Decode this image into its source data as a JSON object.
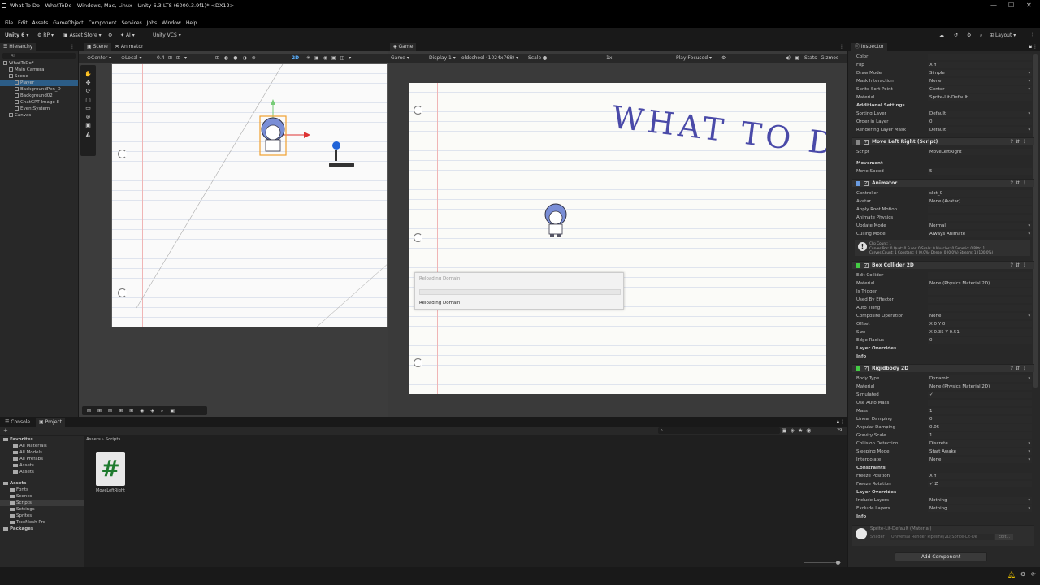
{
  "window": {
    "title": "What To Do - WhatToDo - Windows, Mac, Linux - Unity 6.3 LTS (6000.3.9f1)* <DX12>",
    "minimize": "—",
    "maximize": "☐",
    "close": "✕"
  },
  "menu": [
    "File",
    "Edit",
    "Assets",
    "GameObject",
    "Component",
    "Services",
    "Jobs",
    "Window",
    "Help"
  ],
  "toolbar": {
    "account": "Unity 6",
    "rp": "RP",
    "asset_store": "Asset Store",
    "ai": "AI",
    "vcs": "Unity VCS",
    "layout": "Layout"
  },
  "hierarchy": {
    "tab": "Hierarchy",
    "search_placeholder": "All",
    "items": [
      {
        "label": "WhatToDo*",
        "level": 0,
        "selected": false
      },
      {
        "label": "Main Camera",
        "level": 1,
        "selected": false
      },
      {
        "label": "Scene",
        "level": 1,
        "selected": false
      },
      {
        "label": "Player",
        "level": 2,
        "selected": true
      },
      {
        "label": "BackgroundPen_D",
        "level": 2,
        "selected": false
      },
      {
        "label": "Background02",
        "level": 2,
        "selected": false
      },
      {
        "label": "ChatGPT Image 8",
        "level": 2,
        "selected": false
      },
      {
        "label": "EventSystem",
        "level": 2,
        "selected": false
      },
      {
        "label": "Canvas",
        "level": 1,
        "selected": false
      }
    ]
  },
  "scene": {
    "tab_scene": "Scene",
    "tab_animator": "Animator",
    "pivot": "Center",
    "space": "Local",
    "snap": "0.4",
    "mode_2d": "2D"
  },
  "game": {
    "tab": "Game",
    "mode": "Game",
    "display": "Display 1",
    "resolution": "oldschool (1024x768)",
    "scale_label": "Scale",
    "scale_value": "1x",
    "play_focused": "Play Focused",
    "stats": "Stats",
    "gizmos": "Gizmos",
    "title_art": "WHAT TO DO",
    "dialog_title": "Reloading Domain",
    "dialog_status": "Reloading Domain"
  },
  "inspector": {
    "tab": "Inspector",
    "top_rows": [
      {
        "k": "Color",
        "v": ""
      },
      {
        "k": "Flip",
        "v": "X    Y"
      },
      {
        "k": "Draw Mode",
        "v": "Simple",
        "dd": true
      },
      {
        "k": "Mask Interaction",
        "v": "None",
        "dd": true
      },
      {
        "k": "Sprite Sort Point",
        "v": "Center",
        "dd": true
      },
      {
        "k": "Material",
        "v": "Sprite-Lit-Default"
      }
    ],
    "additional_settings": "Additional Settings",
    "additional_rows": [
      {
        "k": "Sorting Layer",
        "v": "Default",
        "dd": true
      },
      {
        "k": "Order in Layer",
        "v": "0"
      },
      {
        "k": "Rendering Layer Mask",
        "v": "Default",
        "dd": true
      }
    ],
    "move_comp": "Move Left Right (Script)",
    "move_rows": [
      {
        "k": "Script",
        "v": "MoveLeftRight"
      }
    ],
    "movement_header": "Movement",
    "move_speed": {
      "k": "Move Speed",
      "v": "5"
    },
    "animator_comp": "Animator",
    "animator_rows": [
      {
        "k": "Controller",
        "v": "slot_0"
      },
      {
        "k": "Avatar",
        "v": "None (Avatar)"
      },
      {
        "k": "Apply Root Motion",
        "v": ""
      },
      {
        "k": "Animate Physics",
        "v": ""
      },
      {
        "k": "Update Mode",
        "v": "Normal",
        "dd": true
      },
      {
        "k": "Culling Mode",
        "v": "Always Animate",
        "dd": true
      }
    ],
    "clip_info": "Clip Count: 1\nCurves Pos: 0 Quat: 0 Euler: 0 Scale: 0 Muscles: 0 Generic: 0 PPtr: 1\nCurves Count: 1 Constant: 0 (0.0%) Dense: 0 (0.0%) Stream: 1 (100.0%)",
    "box_comp": "Box Collider 2D",
    "box_rows": [
      {
        "k": "Edit Collider",
        "v": ""
      },
      {
        "k": "Material",
        "v": "None (Physics Material 2D)"
      },
      {
        "k": "Is Trigger",
        "v": ""
      },
      {
        "k": "Used By Effector",
        "v": ""
      },
      {
        "k": "Auto Tiling",
        "v": ""
      },
      {
        "k": "Composite Operation",
        "v": "None",
        "dd": true
      },
      {
        "k": "Offset",
        "v": "X 0          Y 0"
      },
      {
        "k": "Size",
        "v": "X 0.35       Y 0.51"
      },
      {
        "k": "Edge Radius",
        "v": "0"
      }
    ],
    "layer_overrides": "Layer Overrides",
    "info": "Info",
    "rb_comp": "Rigidbody 2D",
    "rb_rows": [
      {
        "k": "Body Type",
        "v": "Dynamic",
        "dd": true
      },
      {
        "k": "Material",
        "v": "None (Physics Material 2D)"
      },
      {
        "k": "Simulated",
        "v": "✓"
      },
      {
        "k": "Use Auto Mass",
        "v": ""
      },
      {
        "k": "Mass",
        "v": "1"
      },
      {
        "k": "Linear Damping",
        "v": "0"
      },
      {
        "k": "Angular Damping",
        "v": "0.05"
      },
      {
        "k": "Gravity Scale",
        "v": "1"
      },
      {
        "k": "Collision Detection",
        "v": "Discrete",
        "dd": true
      },
      {
        "k": "Sleeping Mode",
        "v": "Start Awake",
        "dd": true
      },
      {
        "k": "Interpolate",
        "v": "None",
        "dd": true
      }
    ],
    "constraints": "Constraints",
    "constraint_rows": [
      {
        "k": "Freeze Position",
        "v": "X    Y"
      },
      {
        "k": "Freeze Rotation",
        "v": "✓ Z"
      }
    ],
    "layer_overrides2": "Layer Overrides",
    "override_rows": [
      {
        "k": "Include Layers",
        "v": "Nothing",
        "dd": true
      },
      {
        "k": "Exclude Layers",
        "v": "Nothing",
        "dd": true
      }
    ],
    "info2": "Info",
    "material_name": "Sprite-Lit-Default (Material)",
    "shader_label": "Shader",
    "shader_value": "Universal Render Pipeline/2D/Sprite-Lit-De",
    "edit_label": "Edit...",
    "add_component": "Add Component"
  },
  "project": {
    "tab_console": "Console",
    "tab_project": "Project",
    "favorites": "Favorites",
    "fav_items": [
      "All Materials",
      "All Models",
      "All Prefabs",
      "Assets",
      "Assets"
    ],
    "assets": "Assets",
    "asset_items": [
      "Fonts",
      "Scenes",
      "Scripts",
      "Settings",
      "Sprites",
      "TextMesh Pro"
    ],
    "packages": "Packages",
    "breadcrumb_root": "Assets",
    "breadcrumb_sep": "›",
    "breadcrumb_leaf": "Scripts",
    "file_name": "MoveLeftRight",
    "file_glyph": "#",
    "count": "29"
  }
}
